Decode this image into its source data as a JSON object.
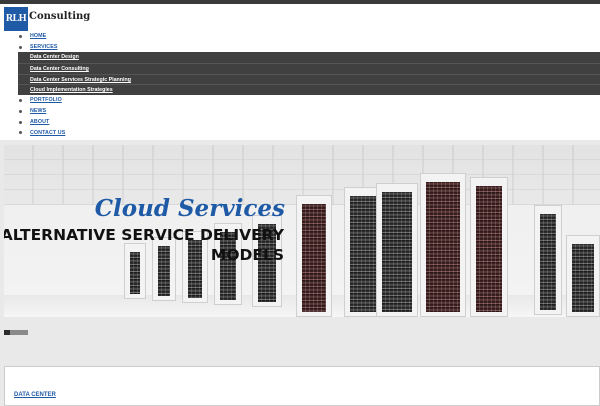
{
  "logo": {
    "mark": "RLH",
    "name": "Consulting"
  },
  "nav": {
    "items": [
      {
        "label": "HOME"
      },
      {
        "label": "SERVICES"
      },
      {
        "label": "PORTFOLIO"
      },
      {
        "label": "NEWS"
      },
      {
        "label": "ABOUT"
      },
      {
        "label": "CONTACT US"
      }
    ],
    "services_submenu": [
      {
        "label": "Data Center Design"
      },
      {
        "label": "Data Center Consulting"
      },
      {
        "label": "Data Center Services Strategic Planning"
      },
      {
        "label": "Cloud Implementation Strategies"
      }
    ]
  },
  "hero": {
    "title": "Cloud Services",
    "subtitle": "ALTERNATIVE SERVICE DELIVERY MODELS"
  },
  "slider": {
    "slide_count": 4,
    "active_index": 0
  },
  "content": {
    "link": "DATA CENTER"
  },
  "colors": {
    "brand_blue": "#1f5aa6",
    "submenu_bg": "#404040",
    "topbar": "#3a3a3a"
  }
}
